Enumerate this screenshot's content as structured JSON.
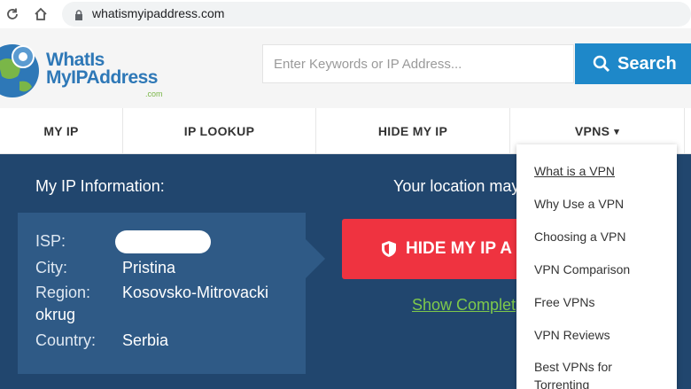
{
  "browser": {
    "url": "whatismyipaddress.com"
  },
  "header": {
    "logo_line1": "WhatIs",
    "logo_line2": "MyIPAddress",
    "logo_suffix": ".com",
    "search_placeholder": "Enter Keywords or IP Address...",
    "search_button": "Search"
  },
  "nav": {
    "items": [
      "MY IP",
      "IP LOOKUP",
      "HIDE MY IP",
      "VPNS"
    ],
    "dropdown_marker": "▾"
  },
  "main": {
    "title": "My IP Information:",
    "location_text": "Your location may",
    "rows": [
      {
        "label": "ISP:",
        "value": ""
      },
      {
        "label": "City:",
        "value": "Pristina"
      },
      {
        "label": "Region:",
        "value": "Kosovsko-Mitrovacki"
      },
      {
        "label": "",
        "value": "okrug"
      },
      {
        "label": "Country:",
        "value": "Serbia"
      }
    ],
    "hide_button": "HIDE MY IP A",
    "show_link": "Show Complet"
  },
  "vpn_menu": {
    "items": [
      "What is a VPN",
      "Why Use a VPN",
      "Choosing a VPN",
      "VPN Comparison",
      "Free VPNs",
      "VPN Reviews",
      "Best VPNs for Torrenting"
    ]
  },
  "colors": {
    "brand_blue": "#1e88c9",
    "panel_dark": "#21466e",
    "panel_box": "#2f5a86",
    "hide_red": "#ef3340",
    "link_green": "#7ec94b"
  }
}
